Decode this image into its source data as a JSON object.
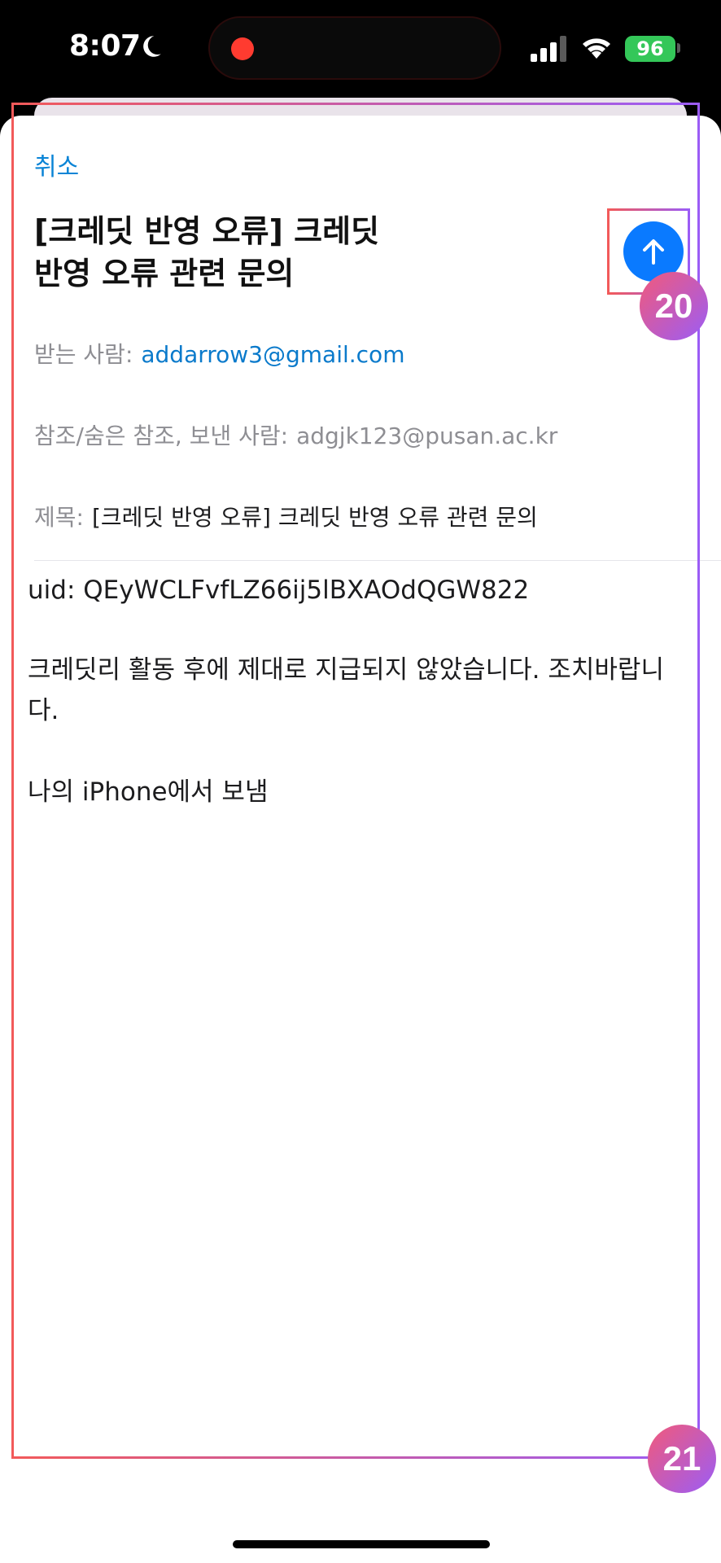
{
  "status_bar": {
    "time": "8:07",
    "battery": "96",
    "recording_dot_color": "#ff3b30",
    "battery_color": "#34c759"
  },
  "compose": {
    "cancel_label": "취소",
    "title_line1": "[크레딧 반영 오류] 크레딧",
    "title_line2": "반영 오류 관련 문의",
    "send_icon": "arrow-up-icon",
    "to_label": "받는 사람:",
    "to_value": "addarrow3@gmail.com",
    "cc_label": "참조/숨은 참조, 보낸 사람:",
    "cc_value": "adgjk123@pusan.ac.kr",
    "subject_label": "제목:",
    "subject_value": "[크레딧 반영 오류] 크레딧 반영 오류 관련 문의",
    "body_uid": "uid: QEyWCLFvfLZ66ij5lBXAOdQGW822",
    "body_message": "크레딧리 활동 후에 제대로 지급되지 않았습니다. 조치바랍니다.",
    "body_signature": "나의 iPhone에서 보냄"
  },
  "annotations": {
    "badge_20": "20",
    "badge_21": "21"
  }
}
